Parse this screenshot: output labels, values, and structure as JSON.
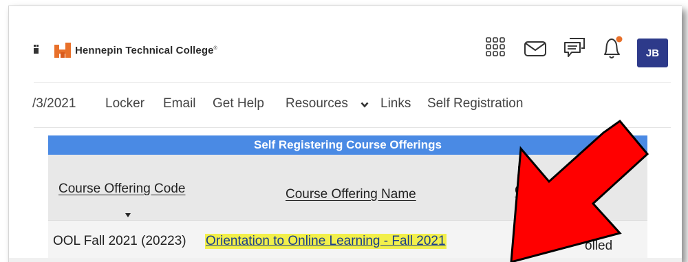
{
  "header": {
    "college_name": "Hennepin Technical College",
    "college_name_mark": "®",
    "avatar_initials": "JB",
    "notification_color": "#e8702a",
    "brand_color": "#e8702a",
    "avatar_color": "#2d3a8a"
  },
  "nav": {
    "date_fragment": "/3/2021",
    "items": [
      "Locker",
      "Email",
      "Get Help",
      "Resources",
      "Links",
      "Self Registration"
    ]
  },
  "table": {
    "title": "Self Registering Course Offerings",
    "title_color": "#4a8ae4",
    "columns": {
      "code": "Course Offering Code",
      "name": "Course Offering Name",
      "status_partial": "C",
      "status_partial_2": "O"
    },
    "rows": [
      {
        "code": "OOL Fall 2021 (20223)",
        "name": "Orientation to Online Learning - Fall 2021",
        "status_partial": "olled"
      }
    ]
  },
  "annotation": {
    "arrow_color": "#ff0000",
    "icon": "red-arrow-pointing-down-left"
  }
}
